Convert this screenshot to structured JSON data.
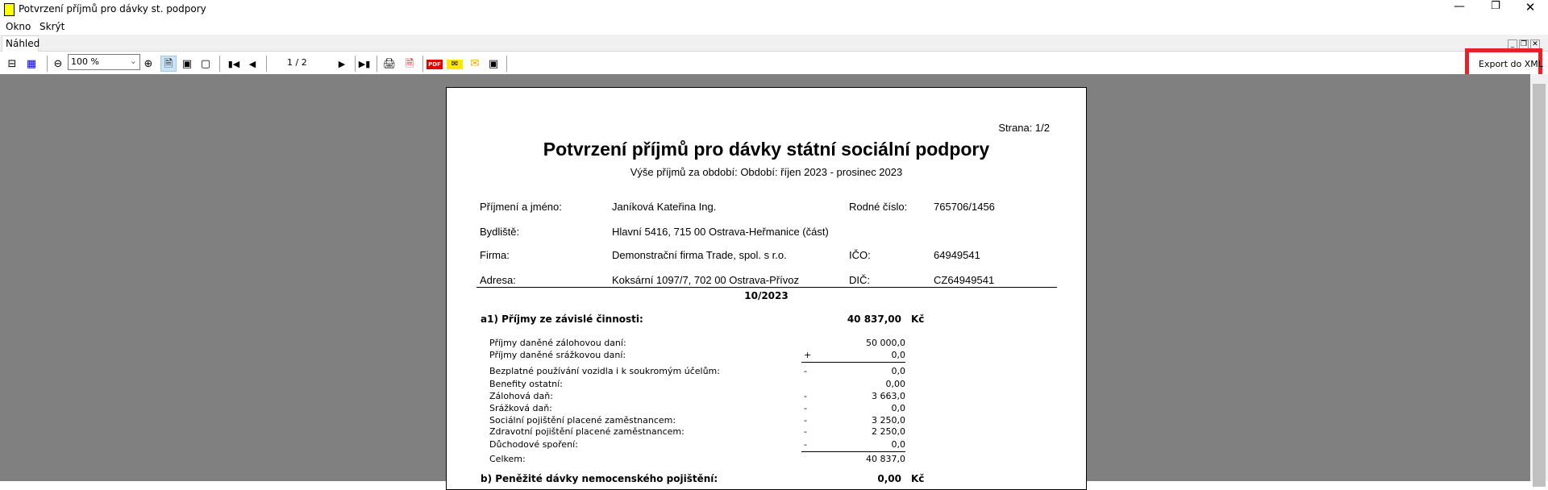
{
  "window": {
    "title": "Potvrzení příjmů pro dávky st. podpory",
    "app_icon": "document-icon",
    "controls": [
      "minimize",
      "restore",
      "close"
    ]
  },
  "menu": [
    {
      "label": "Okno"
    },
    {
      "label": "Skrýt"
    }
  ],
  "tabs": [
    {
      "label": "Náhled",
      "active": true
    }
  ],
  "toolbar": {
    "zoom_value": "100 %",
    "page_indicator": "1 / 2",
    "export_xml_label": "Export do XML",
    "highlight_color": "#e8202a"
  },
  "document": {
    "page_label": "Strana: 1/2",
    "title": "Potvrzení příjmů pro dávky státní sociální podpory",
    "subtitle": "Výše příjmů za období:  Období: říjen 2023 - prosinec 2023",
    "header_rows": [
      {
        "label": "Příjmení a jméno:",
        "value": "Janíková Kateřina Ing.",
        "label2": "Rodné číslo:",
        "value2": "765706/1456"
      },
      {
        "label": "Bydliště:",
        "value": "Hlavní 5416,  715 00  Ostrava-Heřmanice (část)",
        "label2": "",
        "value2": ""
      },
      {
        "label": "Firma:",
        "value": "Demonstrační firma Trade, spol. s r.o.",
        "label2": "IČO:",
        "value2": "64949541"
      },
      {
        "label": "Adresa:",
        "value": "Koksární 1097/7,  702 00  Ostrava-Přívoz",
        "label2": "DIČ:",
        "value2": "CZ64949541"
      }
    ],
    "period": "10/2023",
    "section_a1": {
      "label": "a1)  Příjmy ze závislé činnosti:",
      "amount": "40 837,00",
      "currency": "Kč"
    },
    "details": [
      {
        "label": "Příjmy daněné zálohovou daní:",
        "sign": "",
        "value": "50 000,0"
      },
      {
        "label": "Příjmy daněné srážkovou daní:",
        "sign": "+",
        "value": "0,0"
      },
      {
        "label": "Bezplatné používání vozidla i k soukromým účelům:",
        "sign": "-",
        "value": "0,0"
      },
      {
        "label": "Benefity ostatní:",
        "sign": "",
        "value": "0,00"
      },
      {
        "label": "Zálohová daň:",
        "sign": "-",
        "value": "3 663,0"
      },
      {
        "label": "Srážková daň:",
        "sign": "-",
        "value": "0,0"
      },
      {
        "label": "Sociální pojištění placené zaměstnancem:",
        "sign": "-",
        "value": "3 250,0"
      },
      {
        "label": "Zdravotní pojištění placené zaměstnancem:",
        "sign": "-",
        "value": "2 250,0"
      },
      {
        "label": "Důchodové spoření:",
        "sign": "-",
        "value": "0,0"
      },
      {
        "label": "Celkem:",
        "sign": "",
        "value": "40 837,0"
      }
    ],
    "section_b": {
      "label": "b)    Peněžité dávky nemocenského pojištění:",
      "amount": "0,00",
      "currency": "Kč"
    }
  }
}
